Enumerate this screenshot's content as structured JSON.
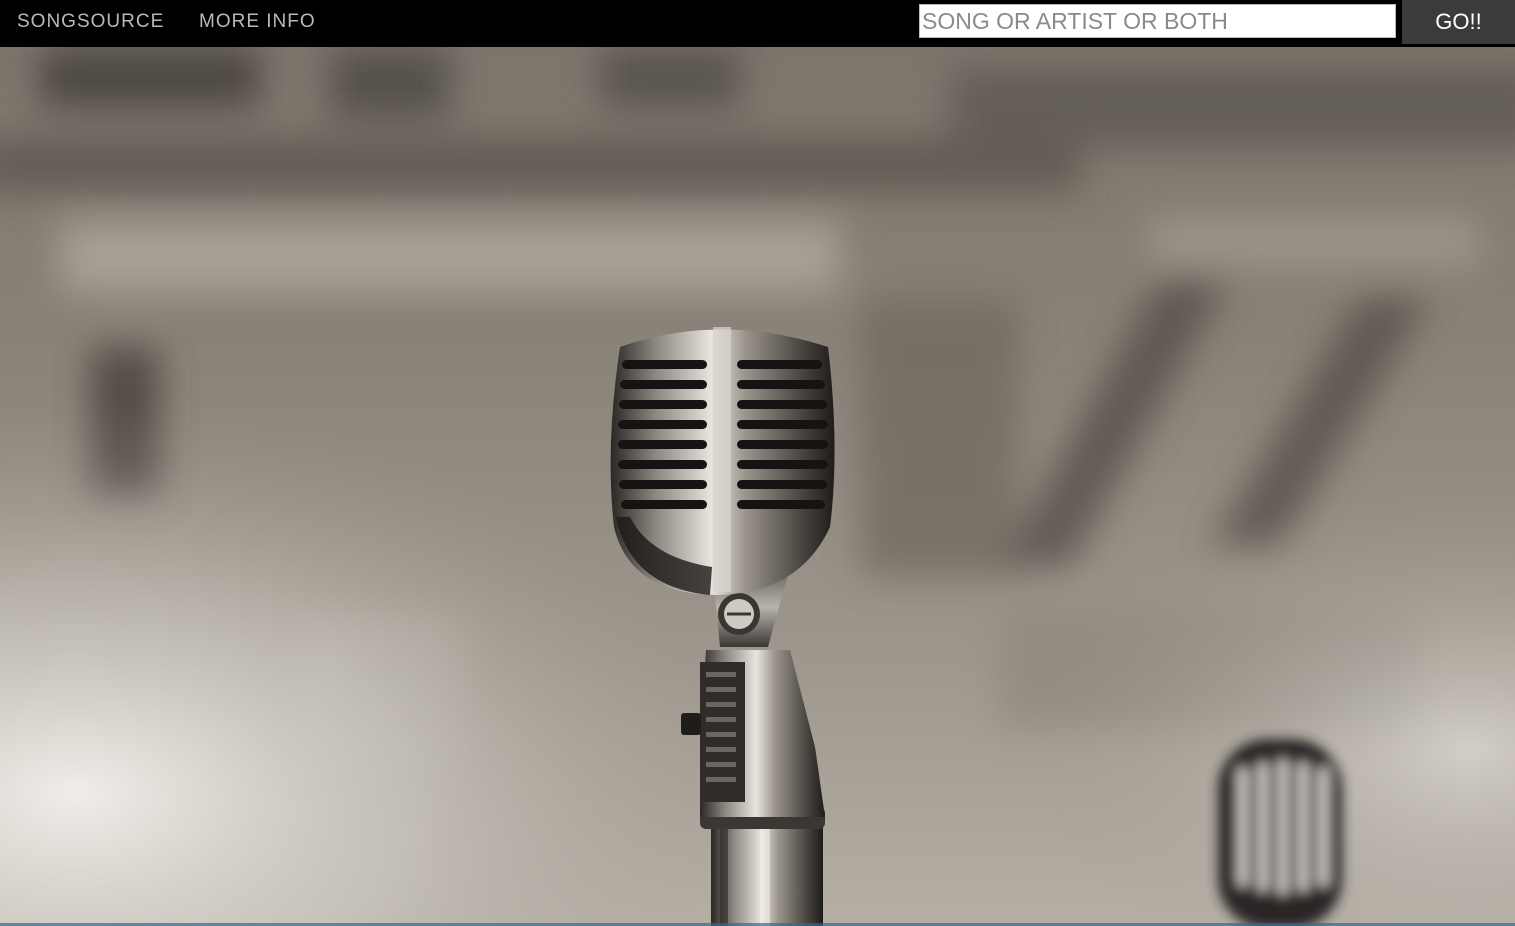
{
  "nav": {
    "brand": "SONGSOURCE",
    "more_info": "MORE INFO"
  },
  "search": {
    "placeholder": "SONG OR ARTIST OR BOTH",
    "value": "",
    "button_label": "GO!!"
  },
  "colors": {
    "navbar_bg": "#000000",
    "nav_text": "#b9b9b9",
    "button_bg": "#3b3b3b",
    "button_text": "#ffffff"
  },
  "hero": {
    "icon": "microphone-icon"
  }
}
